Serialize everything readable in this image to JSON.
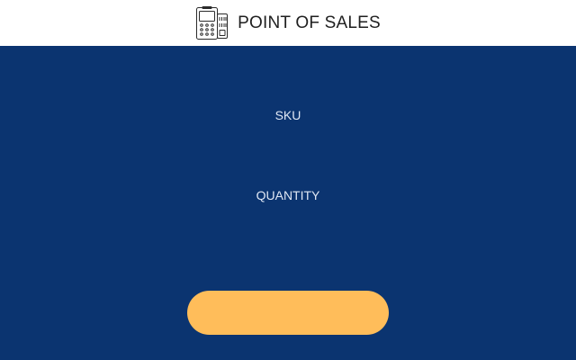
{
  "header": {
    "title": "POINT OF SALES",
    "icon": "pos-terminal-icon"
  },
  "form": {
    "sku_label": "SKU",
    "quantity_label": "QUANTITY",
    "submit_label": ""
  },
  "colors": {
    "header_bg": "#ffffff",
    "page_bg": "#0b3470",
    "label_text": "#dfe7f4",
    "button_bg": "#ffbd5a"
  }
}
